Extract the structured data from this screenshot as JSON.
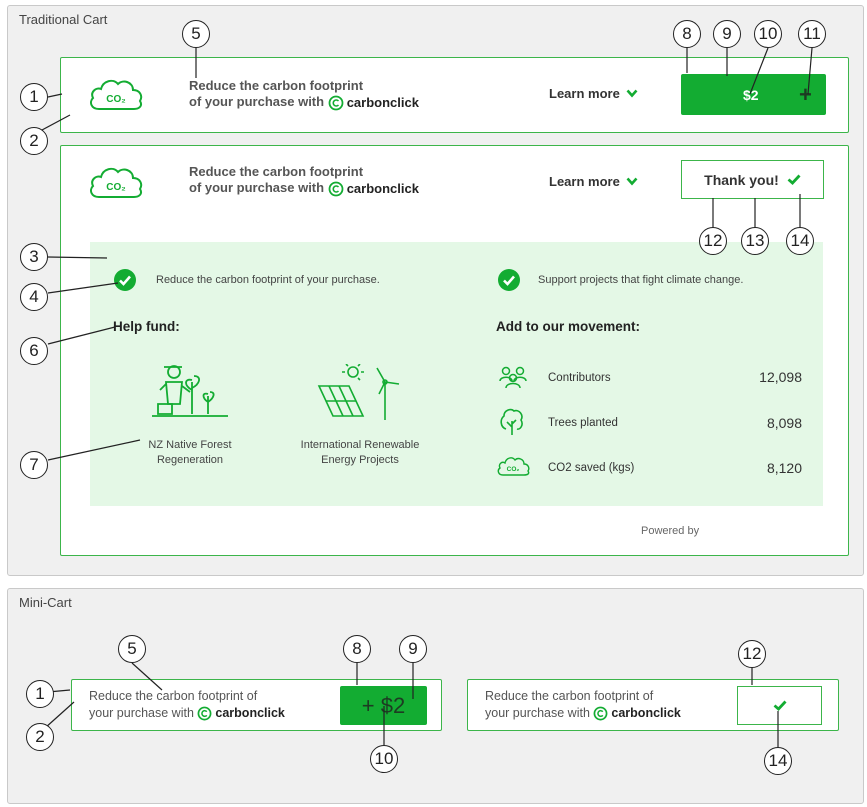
{
  "traditional": {
    "section_title": "Traditional Cart",
    "offer_line1": "Reduce the carbon footprint",
    "offer_line2": "of your purchase with",
    "brand": "carbonclick",
    "cloud_label": "CO₂",
    "learn_more": "Learn more",
    "price": "$2",
    "plus": "+",
    "thank_you": "Thank you!",
    "benefit_1": "Reduce the carbon footprint of your purchase.",
    "benefit_2": "Support projects that fight climate change.",
    "help_fund": "Help fund:",
    "project_1": [
      "NZ Native Forest",
      "Regeneration"
    ],
    "project_2": [
      "International Renewable",
      "Energy Projects"
    ],
    "movement": "Add to our movement:",
    "stats": [
      {
        "label": "Contributors",
        "value": "12,098",
        "icon": "people-icon"
      },
      {
        "label": "Trees planted",
        "value": "8,098",
        "icon": "tree-icon"
      },
      {
        "label": "CO2 saved (kgs)",
        "value": "8,120",
        "icon": "co2-cloud-icon"
      }
    ],
    "stat_cloud_label": "CO₂",
    "powered_by": "Powered by"
  },
  "mini": {
    "section_title": "Mini-Cart",
    "line1": "Reduce the carbon footprint of",
    "line2": "your purchase with",
    "brand": "carbonclick",
    "button_label": "+ $2"
  },
  "callouts": {
    "c1": "1",
    "c2": "2",
    "c3": "3",
    "c4": "4",
    "c5": "5",
    "c6": "6",
    "c7": "7",
    "c8": "8",
    "c9": "9",
    "c10": "10",
    "c11": "11",
    "c12": "12",
    "c13": "13",
    "c14": "14"
  },
  "colors": {
    "brand_green": "#13ac32",
    "border_green": "#3cb54a",
    "panel_green": "#e4f8e6"
  }
}
